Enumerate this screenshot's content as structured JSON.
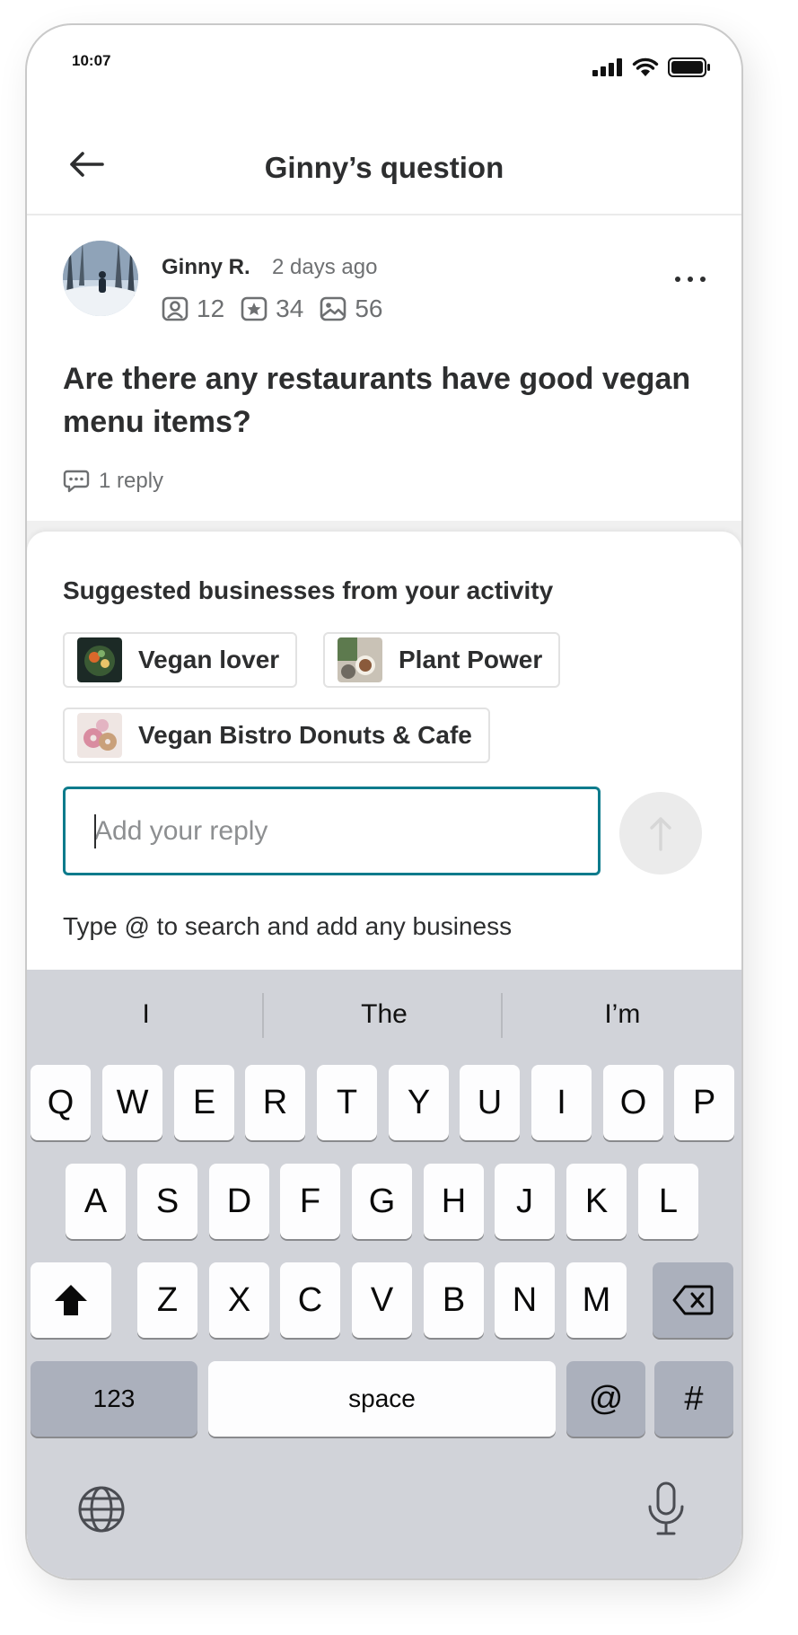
{
  "status_bar": {
    "time": "10:07"
  },
  "nav": {
    "title": "Ginny’s question",
    "back_icon": "arrow-left-icon"
  },
  "question": {
    "author": "Ginny R.",
    "time": "2 days ago",
    "stats": {
      "friends": "12",
      "reviews": "34",
      "photos": "56"
    },
    "text": "Are there any restaurants have good vegan menu items?",
    "reply_count": "1 reply"
  },
  "sheet": {
    "heading": "Suggested businesses from your activity",
    "suggestions": [
      {
        "label": "Vegan lover"
      },
      {
        "label": "Plant Power"
      },
      {
        "label": "Vegan Bistro Donuts & Cafe"
      }
    ],
    "reply_placeholder": "Add your reply",
    "helper": "Type @ to search and add any business"
  },
  "keyboard": {
    "suggestions": [
      "I",
      "The",
      "I’m"
    ],
    "row1": [
      "Q",
      "W",
      "E",
      "R",
      "T",
      "Y",
      "U",
      "I",
      "O",
      "P"
    ],
    "row2": [
      "A",
      "S",
      "D",
      "F",
      "G",
      "H",
      "J",
      "K",
      "L"
    ],
    "row3": [
      "Z",
      "X",
      "C",
      "V",
      "B",
      "N",
      "M"
    ],
    "numbers_label": "123",
    "space_label": "space",
    "at_label": "@",
    "hash_label": "#"
  },
  "colors": {
    "accent": "#0d7b8c",
    "keyboard_bg": "#d1d3d9"
  }
}
